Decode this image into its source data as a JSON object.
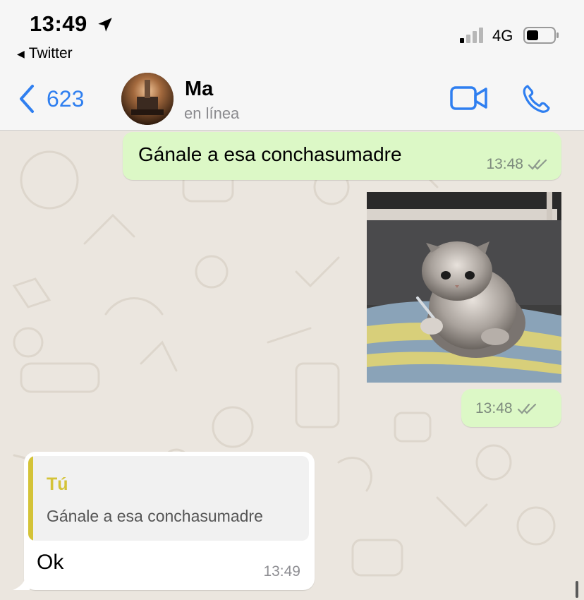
{
  "status_bar": {
    "time": "13:49",
    "back_app": "Twitter",
    "network": "4G",
    "location_icon": "location-arrow-icon",
    "battery_icon": "battery-icon",
    "signal_icon": "signal-icon"
  },
  "header": {
    "back_count": "623",
    "contact_name": "Ma",
    "contact_status": "en línea",
    "accent_color": "#2f7ff0"
  },
  "messages": [
    {
      "direction": "out",
      "text": "Gánale a esa conchasumadre",
      "time": "13:48",
      "status_icon": "double-check-icon"
    },
    {
      "direction": "out",
      "type": "image",
      "image_icon": "kitten-with-knife-photo",
      "time": "13:48",
      "status_icon": "double-check-icon"
    },
    {
      "direction": "in",
      "reply_to": {
        "author": "Tú",
        "text": "Gánale a esa conchasumadre"
      },
      "text": "Ok",
      "time": "13:49"
    }
  ],
  "colors": {
    "outgoing_bubble": "#dcf8c6",
    "incoming_bubble": "#ffffff",
    "chat_background": "#ebe6df",
    "quote_accent": "#d4c338"
  }
}
